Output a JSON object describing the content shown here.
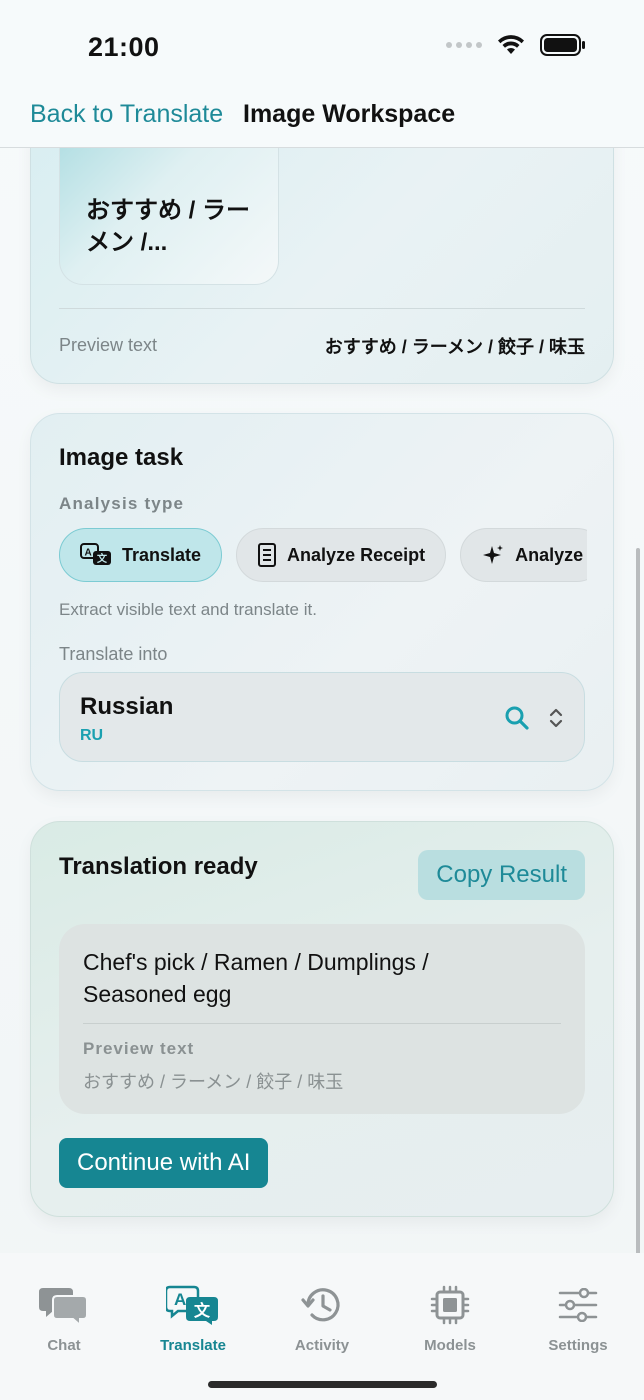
{
  "status_bar": {
    "time": "21:00"
  },
  "nav": {
    "back_label": "Back to Translate",
    "title": "Image Workspace"
  },
  "image_card": {
    "thumbnail_text": "おすすめ / ラーメン /...",
    "preview_label": "Preview text",
    "preview_value": "おすすめ / ラーメン / 餃子 / 味玉"
  },
  "task_card": {
    "title": "Image task",
    "analysis_label": "Analysis type",
    "chips": [
      {
        "label": "Translate",
        "icon": "translate-icon",
        "active": true
      },
      {
        "label": "Analyze Receipt",
        "icon": "receipt-icon",
        "active": false
      },
      {
        "label": "Analyze",
        "icon": "sparkle-icon",
        "active": false
      }
    ],
    "description": "Extract visible text and translate it.",
    "translate_into_label": "Translate into",
    "language": {
      "name": "Russian",
      "code": "RU"
    }
  },
  "result_card": {
    "title": "Translation ready",
    "copy_label": "Copy Result",
    "result_text": "Chef's pick / Ramen / Dumplings / Seasoned egg",
    "preview_label": "Preview text",
    "preview_value": "おすすめ / ラーメン / 餃子 / 味玉",
    "continue_label": "Continue with AI"
  },
  "tabs": [
    {
      "label": "Chat",
      "icon": "chat-icon",
      "active": false
    },
    {
      "label": "Translate",
      "icon": "translate-icon",
      "active": true
    },
    {
      "label": "Activity",
      "icon": "history-icon",
      "active": false
    },
    {
      "label": "Models",
      "icon": "chip-icon",
      "active": false
    },
    {
      "label": "Settings",
      "icon": "sliders-icon",
      "active": false
    }
  ],
  "colors": {
    "accent": "#168692",
    "accent_light": "#1e8a98",
    "active_chip": "#bfe6ea"
  }
}
